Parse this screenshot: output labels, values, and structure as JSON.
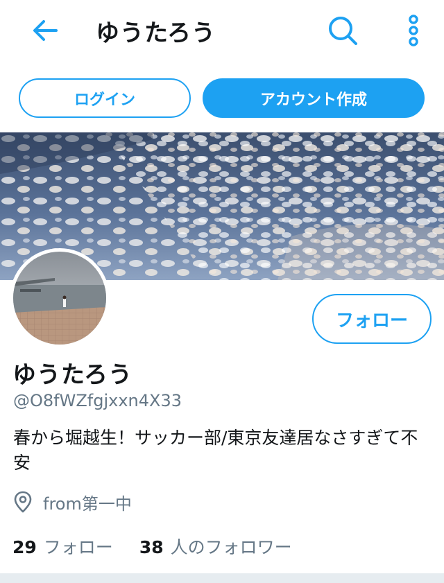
{
  "header": {
    "title": "ゆうたろう",
    "back_icon": "arrow-left-icon",
    "search_icon": "search-icon",
    "more_icon": "more-vertical-icon"
  },
  "auth": {
    "login_label": "ログイン",
    "signup_label": "アカウント作成"
  },
  "profile": {
    "follow_label": "フォロー",
    "display_name": "ゆうたろう",
    "handle": "@O8fWZfgjxxn4X33",
    "bio": "春から堀越生！サッカー部/東京友達居なさすぎて不安",
    "location_icon": "location-pin-icon",
    "location": "from第一中",
    "following_count": "29",
    "following_label": "フォロー",
    "followers_count": "38",
    "followers_label": "人のフォロワー"
  },
  "colors": {
    "accent": "#1da1f2",
    "text_primary": "#14171a",
    "text_secondary": "#657786",
    "divider": "#e6ecf0"
  }
}
